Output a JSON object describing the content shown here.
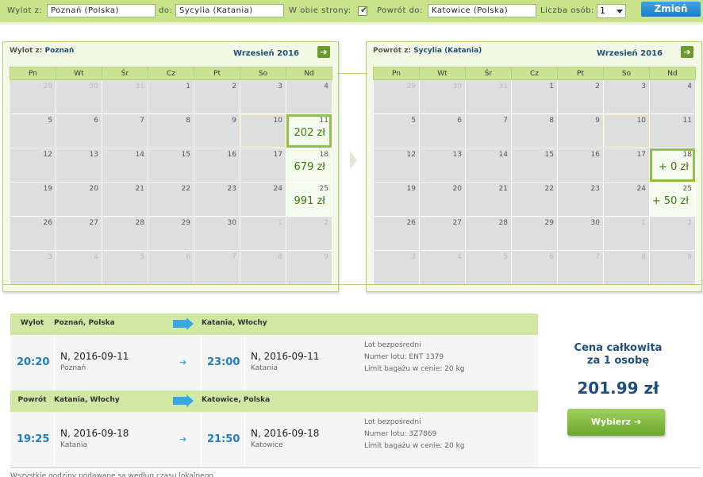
{
  "search": {
    "from_label": "Wylot z:",
    "from_value": "Poznań (Polska)",
    "to_label": "do:",
    "to_value": "Sycylia (Katania)",
    "both_ways_label": "W obie strony:",
    "both_ways_checked": true,
    "return_to_label": "Powrót do:",
    "return_to_value": "Katowice (Polska)",
    "persons_label": "Liczba osób:",
    "persons_value": "1",
    "search_button": "Zmień"
  },
  "weekdays": [
    "Pn",
    "Wt",
    "Śr",
    "Cz",
    "Pt",
    "So",
    "Nd"
  ],
  "outbound_calendar": {
    "from_label": "Wylot z:",
    "from_city": "Poznań",
    "month": "Wrzesień 2016",
    "next_icon": "arrow-right-icon",
    "days": [
      [
        "29",
        "30",
        "31",
        "1",
        "2",
        "3",
        "4"
      ],
      [
        "5",
        "6",
        "7",
        "8",
        "9",
        "10",
        "11"
      ],
      [
        "12",
        "13",
        "14",
        "15",
        "16",
        "17",
        "18"
      ],
      [
        "19",
        "20",
        "21",
        "22",
        "23",
        "24",
        "25"
      ],
      [
        "26",
        "27",
        "28",
        "29",
        "30",
        "1",
        "2"
      ],
      [
        "3",
        "4",
        "5",
        "6",
        "7",
        "8",
        "9"
      ]
    ],
    "prices": {
      "11": "202 zł",
      "18": "679 zł",
      "25": "991 zł"
    },
    "selected_day": "11"
  },
  "return_calendar": {
    "from_label": "Powrót z:",
    "from_city": "Sycylia (Katania)",
    "month": "Wrzesień 2016",
    "next_icon": "arrow-right-icon",
    "days": [
      [
        "29",
        "30",
        "31",
        "1",
        "2",
        "3",
        "4"
      ],
      [
        "5",
        "6",
        "7",
        "8",
        "9",
        "10",
        "11"
      ],
      [
        "12",
        "13",
        "14",
        "15",
        "16",
        "17",
        "18"
      ],
      [
        "19",
        "20",
        "21",
        "22",
        "23",
        "24",
        "25"
      ],
      [
        "26",
        "27",
        "28",
        "29",
        "30",
        "1",
        "2"
      ],
      [
        "3",
        "4",
        "5",
        "6",
        "7",
        "8",
        "9"
      ]
    ],
    "prices": {
      "18": "+ 0 zł",
      "25": "+ 50 zł"
    },
    "selected_day": "18"
  },
  "flights": [
    {
      "direction": "Wylot",
      "from": "Poznań, Polska",
      "to": "Katania, Włochy",
      "dep_time": "20:20",
      "dep_date": "N, 2016-09-11",
      "dep_city": "Poznań",
      "arr_time": "23:00",
      "arr_date": "N, 2016-09-11",
      "arr_city": "Katania",
      "info_type": "Lot bezpośredni",
      "info_flight": "Numer lotu: ENT 1379",
      "info_baggage": "Limit bagażu w cenie: 20 kg"
    },
    {
      "direction": "Powrót",
      "from": "Katania, Włochy",
      "to": "Katowice, Polska",
      "dep_time": "19:25",
      "dep_date": "N, 2016-09-18",
      "dep_city": "Katania",
      "arr_time": "21:50",
      "arr_date": "N, 2016-09-18",
      "arr_city": "Katowice",
      "info_type": "Lot bezpośredni",
      "info_flight": "Numer lotu: 3Z7869",
      "info_baggage": "Limit bagażu w cenie: 20 kg"
    }
  ],
  "price": {
    "title_line1": "Cena całkowita",
    "title_line2": "za 1 osobę",
    "value": "201.99 zł",
    "button": "Wybierz"
  },
  "footer": "Wszystkie godziny podawane są według czasu lokalnego."
}
